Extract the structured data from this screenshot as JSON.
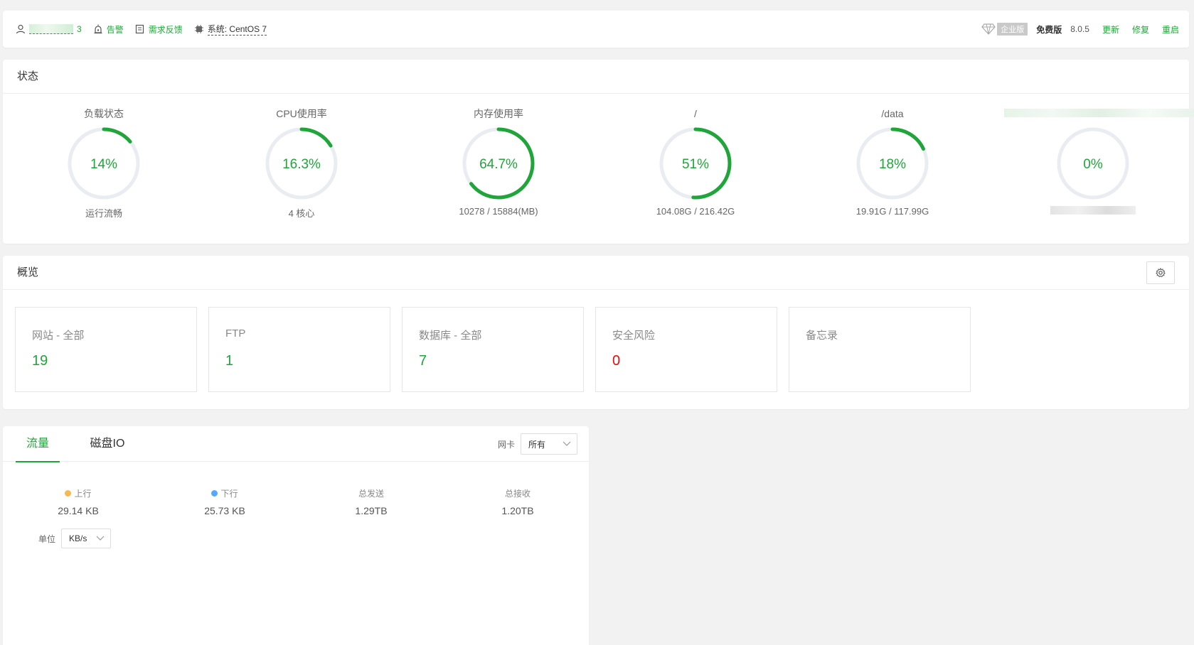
{
  "topbar": {
    "user_suffix": "3",
    "alert_label": "告警",
    "feedback_label": "需求反馈",
    "system_label": "系统:",
    "system_value": "CentOS 7",
    "enterprise_tag": "企业版",
    "free_label": "免费版",
    "version": "8.0.5",
    "update_label": "更新",
    "repair_label": "修复",
    "restart_label": "重启"
  },
  "status": {
    "title": "状态",
    "gauges": [
      {
        "title": "负载状态",
        "value": "14%",
        "percent": 14,
        "sub": "运行流畅"
      },
      {
        "title": "CPU使用率",
        "value": "16.3%",
        "percent": 16.3,
        "sub": "4 核心"
      },
      {
        "title": "内存使用率",
        "value": "64.7%",
        "percent": 64.7,
        "sub": "10278 / 15884(MB)"
      },
      {
        "title": "/",
        "value": "51%",
        "percent": 51,
        "sub": "104.08G / 216.42G"
      },
      {
        "title": "/data",
        "value": "18%",
        "percent": 18,
        "sub": "19.91G / 117.99G"
      },
      {
        "title": "",
        "value": "0%",
        "percent": 0,
        "sub": ""
      }
    ]
  },
  "overview": {
    "title": "概览",
    "cards": [
      {
        "label": "网站 - 全部",
        "value": "19"
      },
      {
        "label": "FTP",
        "value": "1"
      },
      {
        "label": "数据库 - 全部",
        "value": "7"
      },
      {
        "label": "安全风险",
        "value": "0"
      },
      {
        "label": "备忘录",
        "value": ""
      }
    ]
  },
  "traffic": {
    "tabs": [
      "流量",
      "磁盘IO"
    ],
    "nic_label": "网卡",
    "nic_value": "所有",
    "stats": [
      {
        "label": "上行",
        "value": "29.14 KB"
      },
      {
        "label": "下行",
        "value": "25.73 KB"
      },
      {
        "label": "总发送",
        "value": "1.29TB"
      },
      {
        "label": "总接收",
        "value": "1.20TB"
      }
    ],
    "unit_label": "单位",
    "unit_value": "KB/s"
  },
  "colors": {
    "accent": "#20a53a",
    "gauge_track": "#e9edf2",
    "danger": "#ef0808",
    "upload_dot": "#f7b851",
    "download_dot": "#52a9ff"
  }
}
